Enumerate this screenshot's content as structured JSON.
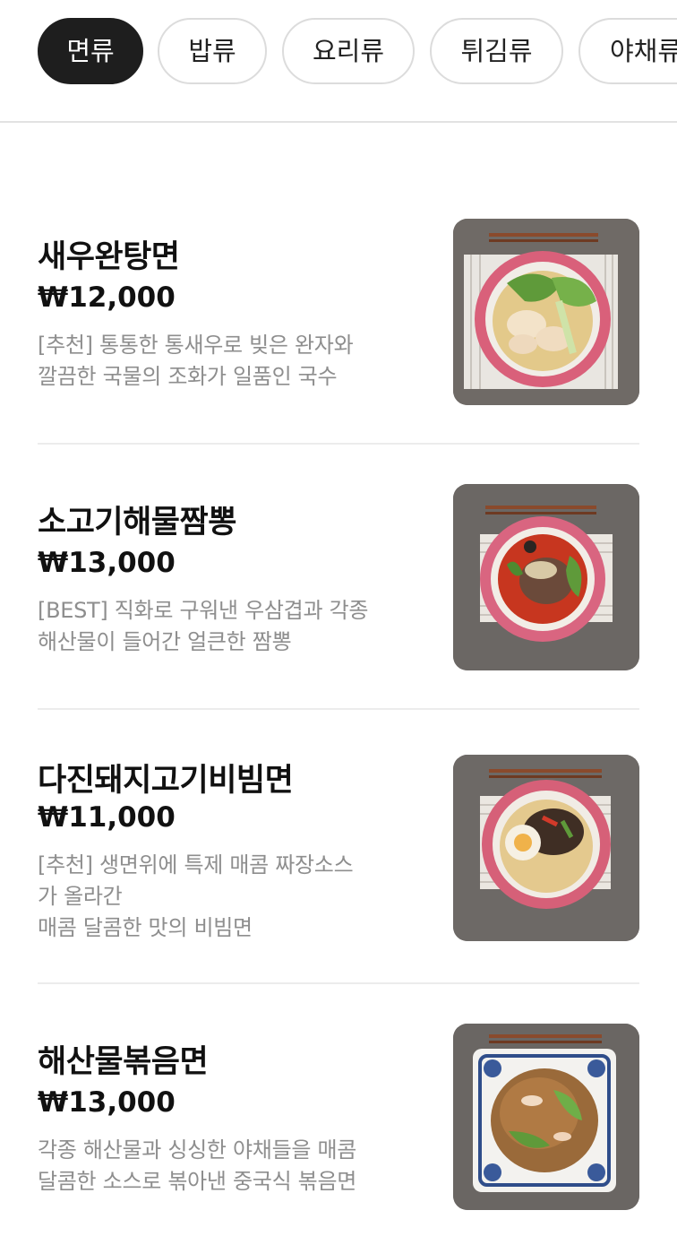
{
  "categories": [
    {
      "label": "면류",
      "active": true
    },
    {
      "label": "밥류",
      "active": false
    },
    {
      "label": "요리류",
      "active": false
    },
    {
      "label": "튀김류",
      "active": false
    },
    {
      "label": "야채류",
      "active": false
    }
  ],
  "menu": [
    {
      "name": "새우완탕면",
      "price": "₩12,000",
      "description": "[추천] 통통한 통새우로 빚은 완자와\n깔끔한 국물의 조화가 일품인 국수",
      "image_icon": "wonton-noodle-soup-photo"
    },
    {
      "name": "소고기해물짬뽕",
      "price": "₩13,000",
      "description": "[BEST] 직화로 구워낸 우삼겹과 각종\n해산물이 들어간 얼큰한 짬뽕",
      "image_icon": "beef-seafood-jjamppong-photo"
    },
    {
      "name": "다진돼지고기비빔면",
      "price": "₩11,000",
      "description": "[추천] 생면위에 특제 매콤 짜장소스\n가 올라간\n매콤 달콤한 맛의 비빔면",
      "image_icon": "minced-pork-bibim-noodle-photo"
    },
    {
      "name": "해산물볶음면",
      "price": "₩13,000",
      "description": "각종 해산물과 싱싱한 야채들을 매콤\n달콤한 소스로 볶아낸 중국식 볶음면",
      "image_icon": "seafood-fried-noodle-photo"
    }
  ]
}
